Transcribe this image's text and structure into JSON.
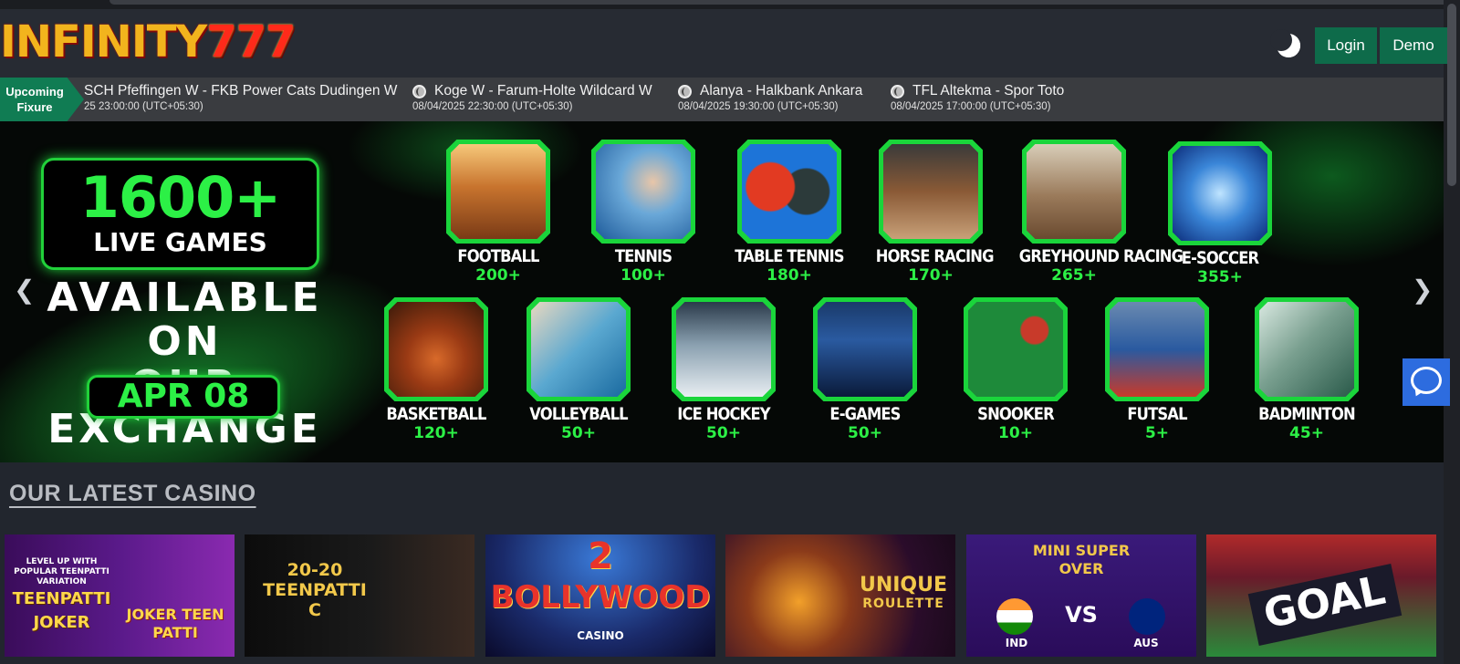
{
  "header": {
    "logo_part1": "INFINITY",
    "logo_part2": "777",
    "login_label": "Login",
    "demo_label": "Demo",
    "theme_icon": "moon-icon"
  },
  "ticker": {
    "label": "Upcoming Fixure",
    "fixtures": [
      {
        "name": "SCH Pfeffingen W - FKB Power Cats Dudingen W",
        "time": "25 23:00:00 (UTC+05:30)"
      },
      {
        "name": "Koge W - Farum-Holte Wildcard W",
        "time": "08/04/2025 22:30:00 (UTC+05:30)"
      },
      {
        "name": "Alanya - Halkbank Ankara",
        "time": "08/04/2025 19:30:00 (UTC+05:30)"
      },
      {
        "name": "TFL Altekma - Spor Toto",
        "time": "08/04/2025 17:00:00 (UTC+05:30)"
      }
    ]
  },
  "banner": {
    "promo_big": "1600+",
    "promo_small": "LIVE GAMES",
    "available_line1": "AVAILABLE ON",
    "available_line2": "OUR EXCHANGE",
    "date": "APR 08",
    "sports_row1": [
      {
        "label": "FOOTBALL",
        "count": "200+"
      },
      {
        "label": "TENNIS",
        "count": "100+"
      },
      {
        "label": "TABLE TENNIS",
        "count": "180+"
      },
      {
        "label": "HORSE RACING",
        "count": "170+"
      },
      {
        "label": "GREYHOUND RACING",
        "count": "265+"
      },
      {
        "label": "E-SOCCER",
        "count": "355+"
      }
    ],
    "sports_row2": [
      {
        "label": "BASKETBALL",
        "count": "120+"
      },
      {
        "label": "VOLLEYBALL",
        "count": "50+"
      },
      {
        "label": "ICE HOCKEY",
        "count": "50+"
      },
      {
        "label": "E-GAMES",
        "count": "50+"
      },
      {
        "label": "SNOOKER",
        "count": "10+"
      },
      {
        "label": "FUTSAL",
        "count": "5+"
      },
      {
        "label": "BADMINTON",
        "count": "45+"
      }
    ]
  },
  "casino": {
    "section_title": "OUR LATEST CASINO",
    "games": [
      {
        "tag": "LEVEL UP WITH POPULAR TEENPATTI VARIATION",
        "title": "TEENPATTI JOKER",
        "logo": "JOKER TEEN PATTI"
      },
      {
        "title": "20-20 TEENPATTI C"
      },
      {
        "title": "BOLLYWOOD",
        "number": "2",
        "sub": "CASINO"
      },
      {
        "title": "UNIQUE",
        "sub": "ROULETTE"
      },
      {
        "title": "MINI SUPER OVER",
        "team1": "IND",
        "vs": "VS",
        "team2": "AUS"
      },
      {
        "title": "GOAL"
      }
    ]
  },
  "colors": {
    "accent_green": "#2cf046",
    "button_green": "#0e6b4a",
    "background": "#22262e"
  }
}
